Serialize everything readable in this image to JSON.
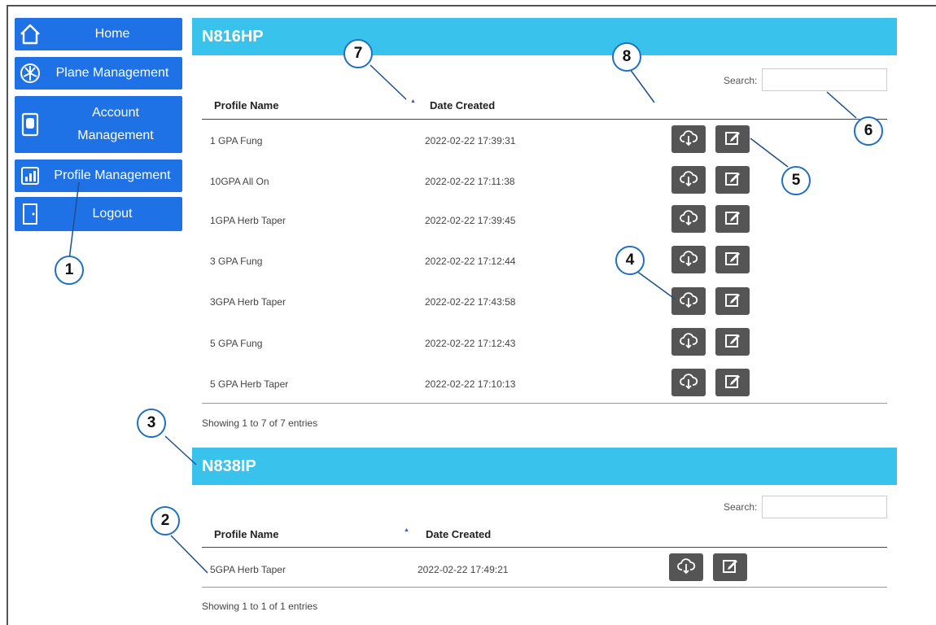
{
  "sidebar": {
    "items": [
      {
        "label": "Home",
        "icon": "home-icon"
      },
      {
        "label": "Plane Management",
        "icon": "fan-icon"
      },
      {
        "label": "Account Management",
        "icon": "account-icon"
      },
      {
        "label": "Profile Management",
        "icon": "chart-icon"
      },
      {
        "label": "Logout",
        "icon": "door-icon"
      }
    ]
  },
  "search_label": "Search:",
  "columns": {
    "profile_name": "Profile Name",
    "date_created": "Date Created"
  },
  "panels": [
    {
      "title": "N816HP",
      "rows": [
        {
          "name": "1 GPA Fung",
          "date": "2022-02-22 17:39:31"
        },
        {
          "name": "10GPA All On",
          "date": "2022-02-22 17:11:38"
        },
        {
          "name": "1GPA Herb Taper",
          "date": "2022-02-22 17:39:45"
        },
        {
          "name": "3 GPA Fung",
          "date": "2022-02-22 17:12:44"
        },
        {
          "name": "3GPA Herb Taper",
          "date": "2022-02-22 17:43:58"
        },
        {
          "name": "5 GPA Fung",
          "date": "2022-02-22 17:12:43"
        },
        {
          "name": "5 GPA Herb Taper",
          "date": "2022-02-22 17:10:13"
        }
      ],
      "info": "Showing 1 to 7 of 7 entries"
    },
    {
      "title": "N838IP",
      "rows": [
        {
          "name": "5GPA Herb Taper",
          "date": "2022-02-22 17:49:21"
        }
      ],
      "info": "Showing 1 to 1 of 1 entries"
    }
  ],
  "callouts": [
    "1",
    "2",
    "3",
    "4",
    "5",
    "6",
    "7",
    "8"
  ],
  "colors": {
    "nav": "#1f72e6",
    "panel_header": "#39c3ec",
    "action_button": "#555555",
    "callout_border": "#1f6fc2"
  }
}
